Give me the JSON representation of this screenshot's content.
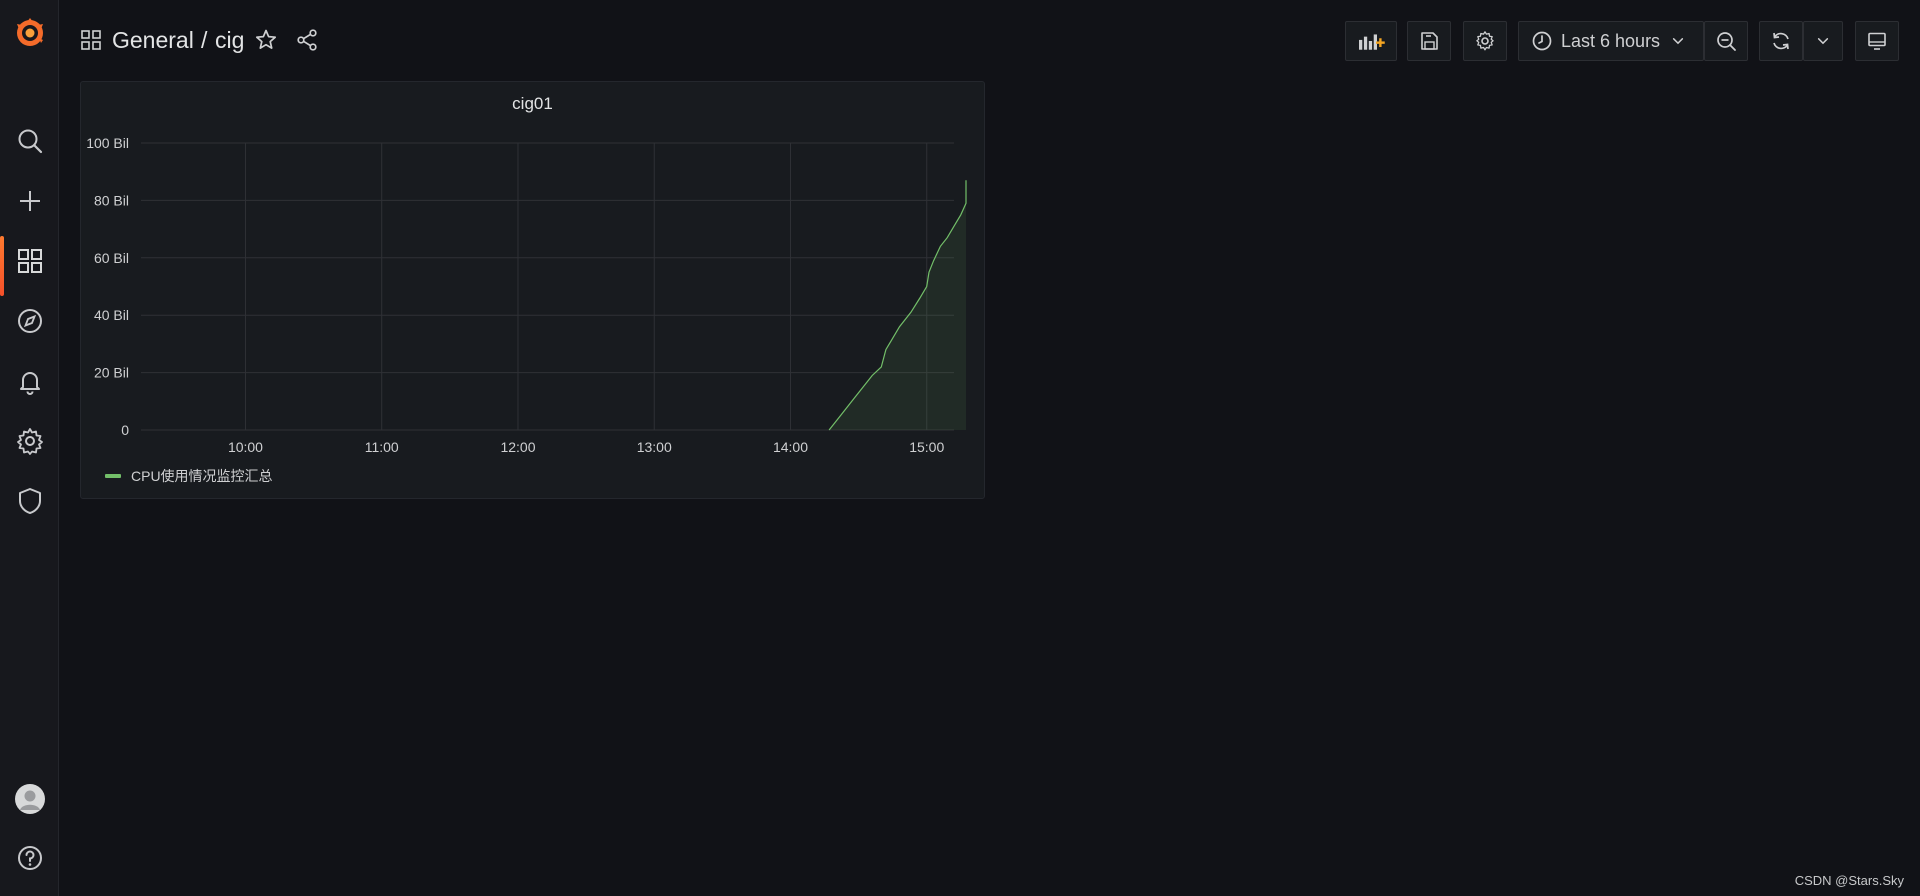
{
  "breadcrumb": {
    "folder": "General",
    "separator": "/",
    "dashboard": "cig"
  },
  "time_picker": {
    "label": "Last 6 hours"
  },
  "sidebar": {
    "items": [
      {
        "icon": "search-icon"
      },
      {
        "icon": "plus-icon"
      },
      {
        "icon": "dashboards-icon",
        "active": true
      },
      {
        "icon": "compass-icon"
      },
      {
        "icon": "bell-icon"
      },
      {
        "icon": "gear-icon"
      },
      {
        "icon": "shield-icon"
      }
    ],
    "bottom": [
      {
        "icon": "avatar"
      },
      {
        "icon": "help-icon"
      }
    ]
  },
  "colors": {
    "accent": "#f5502a",
    "series": "#73bf69",
    "background": "#111217",
    "panel": "#181b1f"
  },
  "watermark": "CSDN @Stars.Sky",
  "chart_data": {
    "type": "area",
    "title": "cig01",
    "xlabel": "",
    "ylabel": "",
    "x_ticks": [
      "10:00",
      "11:00",
      "12:00",
      "13:00",
      "14:00",
      "15:00"
    ],
    "y_ticks": [
      "0",
      "20 Bil",
      "40 Bil",
      "60 Bil",
      "80 Bil",
      "100 Bil"
    ],
    "ylim": [
      0,
      100
    ],
    "y_unit": "Bil",
    "xlim": [
      "09:14",
      "15:12"
    ],
    "grid": true,
    "legend": "bottom-left",
    "series": [
      {
        "name": "CPU使用情况监控汇总",
        "color": "#73bf69",
        "points": [
          [
            "14:17",
            0
          ],
          [
            "14:22",
            5
          ],
          [
            "14:27",
            10
          ],
          [
            "14:32",
            15
          ],
          [
            "14:36",
            19
          ],
          [
            "14:40",
            22
          ],
          [
            "14:42",
            28
          ],
          [
            "14:45",
            32
          ],
          [
            "14:48",
            36
          ],
          [
            "14:53",
            41
          ],
          [
            "14:57",
            46
          ],
          [
            "15:00",
            50
          ],
          [
            "15:01",
            55
          ],
          [
            "15:03",
            59
          ],
          [
            "15:06",
            64
          ],
          [
            "15:09",
            67
          ],
          [
            "15:12",
            71
          ],
          [
            "15:15",
            75
          ],
          [
            "15:18",
            79
          ],
          [
            "15:21",
            83
          ],
          [
            "15:24",
            87
          ]
        ]
      }
    ]
  }
}
